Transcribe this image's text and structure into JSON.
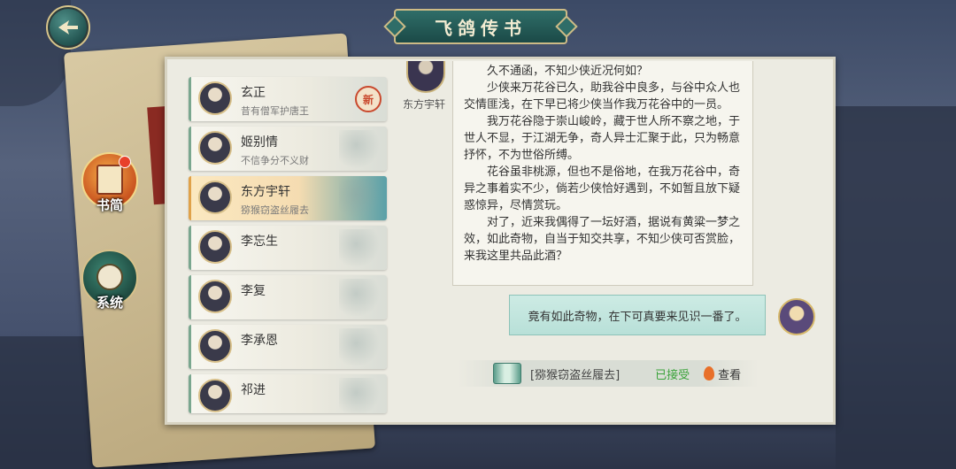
{
  "title": "飞鸽传书",
  "side_buttons": [
    {
      "label": "书简"
    },
    {
      "label": "系统"
    }
  ],
  "contacts": [
    {
      "name": "玄正",
      "subtitle": "昔有僧军护唐王",
      "badge": "新"
    },
    {
      "name": "姬别情",
      "subtitle": "不信争分不义财"
    },
    {
      "name": "东方宇轩",
      "subtitle": "猕猴窃盗丝履去",
      "active": true
    },
    {
      "name": "李忘生",
      "subtitle": ""
    },
    {
      "name": "李复",
      "subtitle": ""
    },
    {
      "name": "李承恩",
      "subtitle": ""
    },
    {
      "name": "祁进",
      "subtitle": ""
    }
  ],
  "conversation": {
    "sender_name": "东方宇轩",
    "top_cut": "",
    "paragraphs": [
      "久不通函，不知少侠近况何如？",
      "少侠来万花谷已久，助我谷中良多，与谷中众人也交情匪浅，在下早已将少侠当作我万花谷中的一员。",
      "我万花谷隐于崇山峻岭，藏于世人所不察之地，于世人不显，于江湖无争，奇人异士汇聚于此，只为畅意抒怀，不为世俗所缚。",
      "花谷虽非桃源，但也不是俗地，在我万花谷中，奇异之事着实不少，倘若少侠恰好遇到，不如暂且放下疑惑惊异，尽情赏玩。",
      "对了，近来我偶得了一坛好酒，据说有黄粱一梦之效，如此奇物，自当于知交共享，不知少侠可否赏脸，来我这里共品此酒？"
    ],
    "reply": "竟有如此奇物，在下可真要来见识一番了。",
    "quest": {
      "name": "[猕猴窃盗丝履去]",
      "status": "已接受",
      "view_label": "查看"
    }
  }
}
